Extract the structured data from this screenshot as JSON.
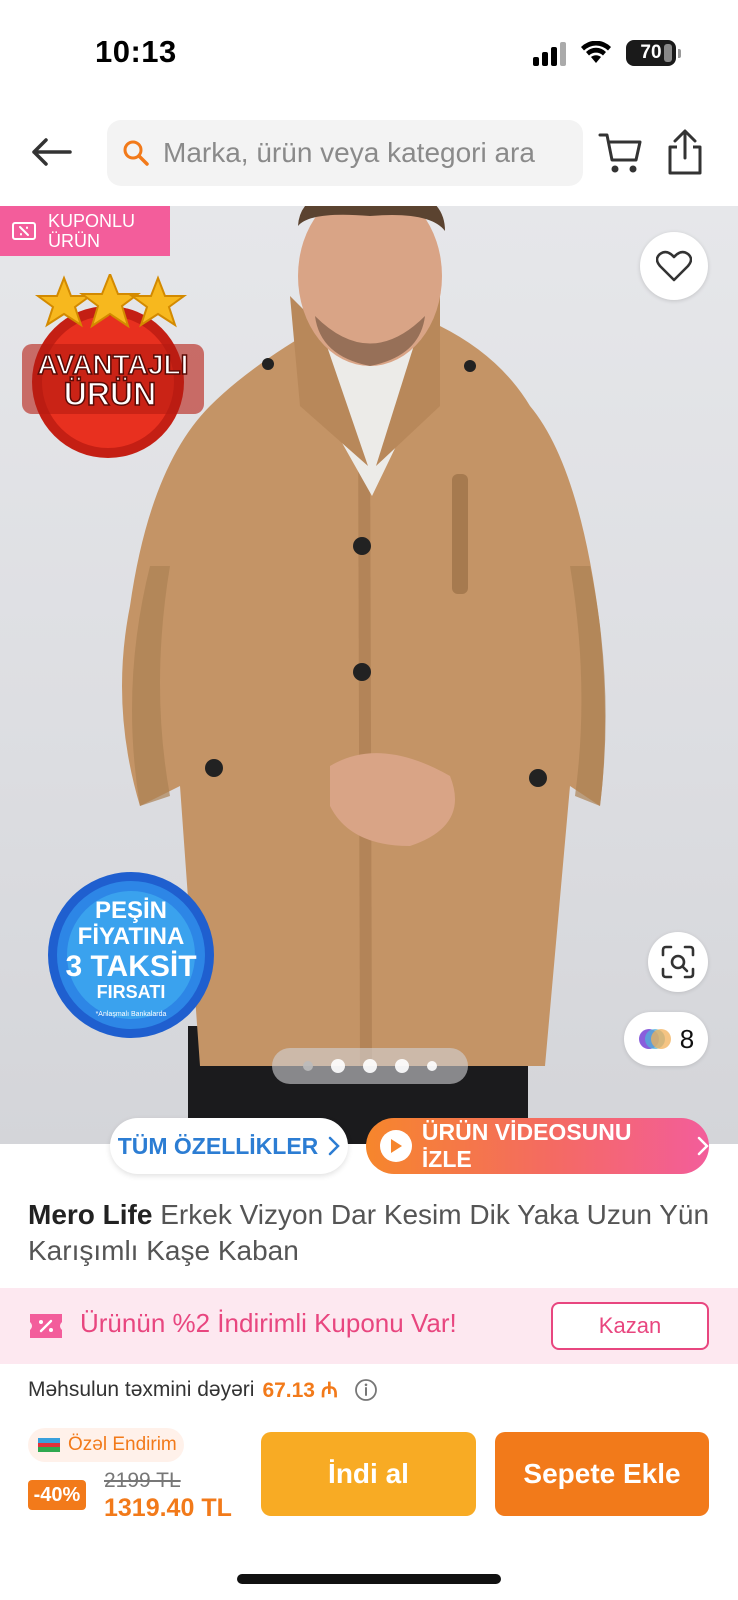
{
  "status_bar": {
    "time": "10:13",
    "battery_level": "70",
    "icons": [
      "cellular-signal-icon",
      "wifi-icon",
      "battery-icon"
    ]
  },
  "header": {
    "back_icon": "arrow-left-icon",
    "search_placeholder": "Marka, ürün veya kategori ara",
    "search_icon": "search-icon",
    "cart_icon": "cart-icon",
    "share_icon": "share-icon"
  },
  "hero": {
    "coupon_tag_line1": "KUPONLU",
    "coupon_tag_line2": "ÜRÜN",
    "badge_avantaj_line1": "AVANTAJLI",
    "badge_avantaj_line2": "ÜRÜN",
    "badge_pesin_line1": "PEŞİN",
    "badge_pesin_line2": "FİYATINA",
    "badge_pesin_line3": "3 TAKSİT",
    "badge_pesin_line4": "FIRSATI",
    "badge_pesin_note": "*Anlaşmalı Bankalarda",
    "color_count": "8",
    "page_total": 5,
    "page_current": 4
  },
  "actions": {
    "all_features": "TÜM ÖZELLİKLER",
    "watch_video": "ÜRÜN VİDEOSUNU İZLE"
  },
  "product": {
    "brand": "Mero Life",
    "name": "Erkek Vizyon Dar Kesim Dik Yaka Uzun Yün Karışımlı Kaşe Kaban"
  },
  "coupon": {
    "text": "Ürünün %2 İndirimli Kuponu Var!",
    "button": "Kazan"
  },
  "estimate": {
    "label": "Məhsulun təxmini dəyəri",
    "amount": "67.13 ₼"
  },
  "pricing": {
    "special_label": "Özəl Endirim",
    "discount": "-40%",
    "old_price": "2199 TL",
    "new_price": "1319.40 TL"
  },
  "buttons": {
    "buy_now": "İndi al",
    "add_to_cart": "Sepete Ekle"
  },
  "colors": {
    "orange": "#f27a1a",
    "yellow": "#f8ab24",
    "pink": "#e8467f",
    "blue": "#2c7dd3"
  }
}
